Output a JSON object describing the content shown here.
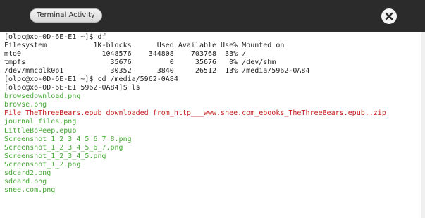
{
  "toolbar": {
    "tab_label": "Terminal Activity",
    "close_icon": "close-circle-icon"
  },
  "colors": {
    "toolbar_bg": "#2b2b2b",
    "text_default": "#1f1f1f",
    "file_green": "#4aa83a",
    "file_red": "#c41a1a"
  },
  "terminal": {
    "lines": [
      {
        "text": "[olpc@xo-0D-6E-E1 ~]$ df",
        "color": "default"
      },
      {
        "text": "Filesystem           1K-blocks      Used Available Use% Mounted on",
        "color": "default"
      },
      {
        "text": "mtd0                   1048576    344808    703768  33% /",
        "color": "default"
      },
      {
        "text": "tmpfs                    35676         0     35676   0% /dev/shm",
        "color": "default"
      },
      {
        "text": "/dev/mmcblk0p1           30352      3840     26512  13% /media/5962-0A84",
        "color": "default"
      },
      {
        "text": "[olpc@xo-0D-6E-E1 ~]$ cd /media/5962-0A84",
        "color": "default"
      },
      {
        "text": "[olpc@xo-0D-6E-E1 5962-0A84]$ ls",
        "color": "default"
      },
      {
        "text": "browsedownload.png",
        "color": "green"
      },
      {
        "text": "browse.png",
        "color": "green"
      },
      {
        "text": "File TheThreeBears.epub downloaded from_http___www.snee.com_ebooks_TheThreeBears.epub..zip",
        "color": "red"
      },
      {
        "text": "journal files.png",
        "color": "green"
      },
      {
        "text": "LittleBoPeep.epub",
        "color": "green"
      },
      {
        "text": "Screenshot_1_2_3_4_5_6_7_8.png",
        "color": "green"
      },
      {
        "text": "Screenshot_1_2_3_4_5_6_7.png",
        "color": "green"
      },
      {
        "text": "Screenshot_1_2_3_4_5.png",
        "color": "green"
      },
      {
        "text": "Screenshot_1_2.png",
        "color": "green"
      },
      {
        "text": "sdcard2.png",
        "color": "green"
      },
      {
        "text": "sdcard.png",
        "color": "green"
      },
      {
        "text": "snee.com.png",
        "color": "green"
      }
    ]
  }
}
